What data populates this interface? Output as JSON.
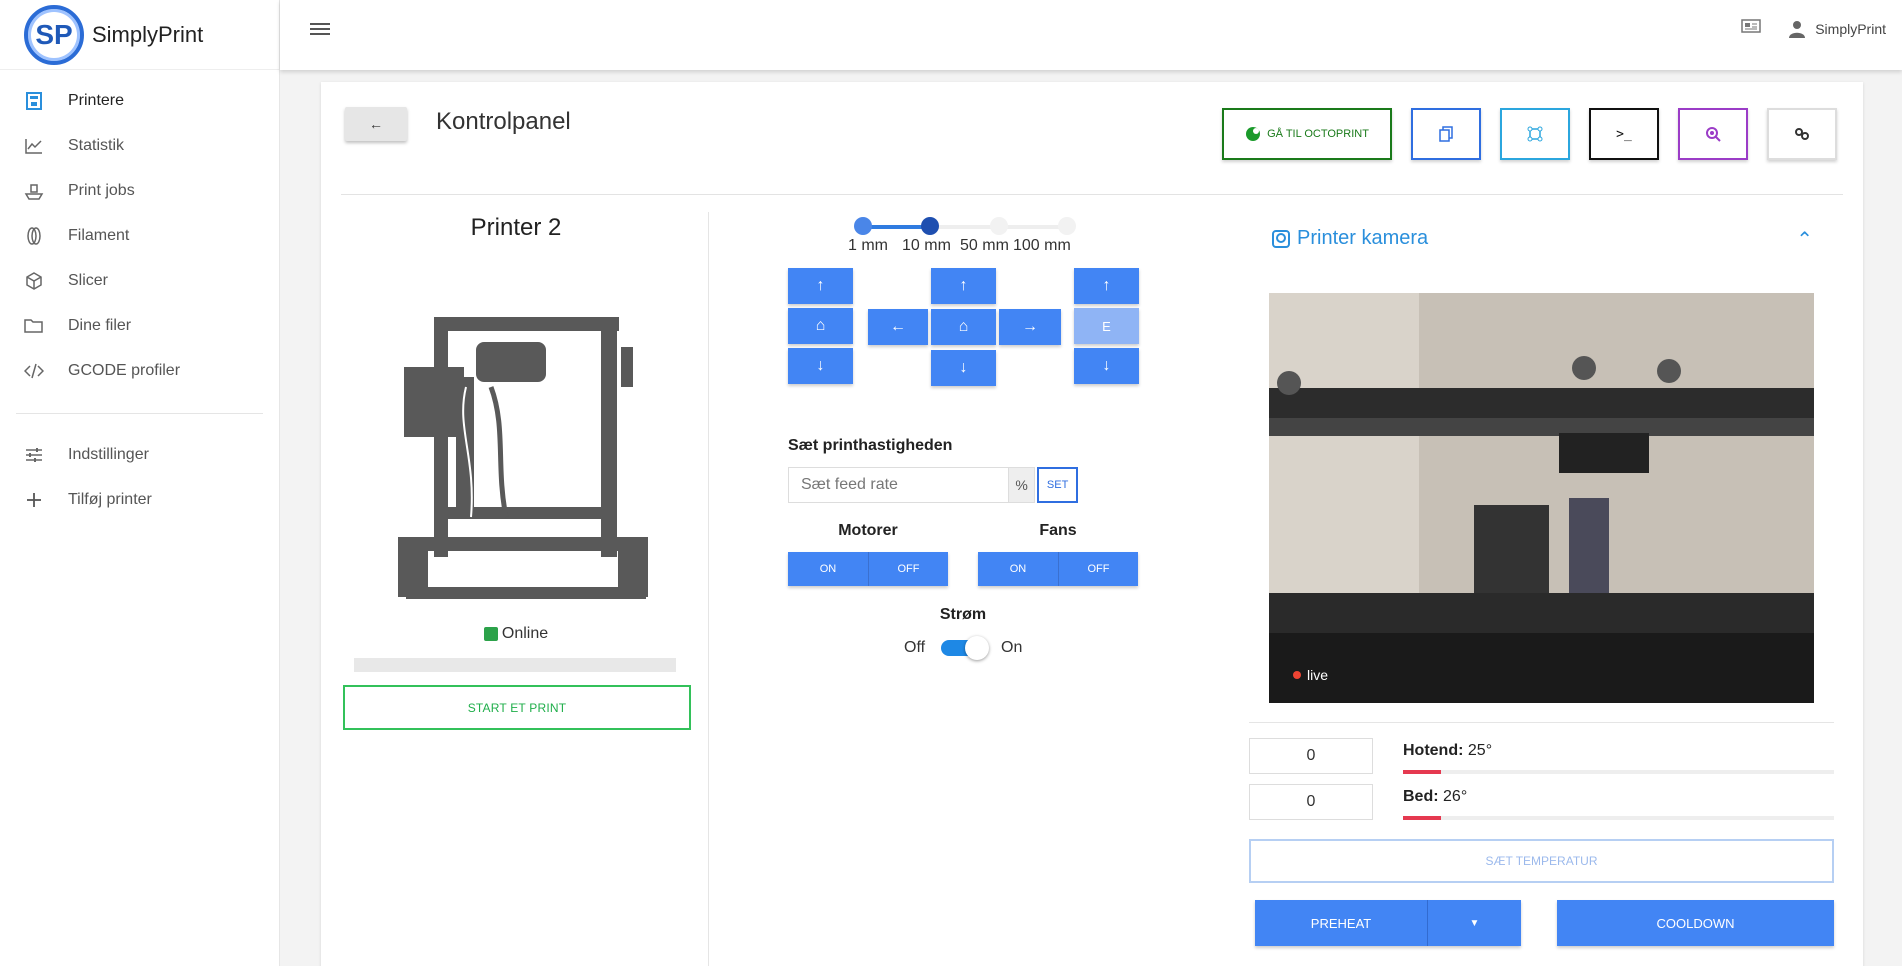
{
  "brand": {
    "name": "SimplyPrint",
    "logo_text": "SP"
  },
  "sidebar": {
    "items": [
      {
        "label": "Printere",
        "icon": "printer-icon"
      },
      {
        "label": "Statistik",
        "icon": "chart-icon"
      },
      {
        "label": "Print jobs",
        "icon": "boat-icon"
      },
      {
        "label": "Filament",
        "icon": "filament-icon"
      },
      {
        "label": "Slicer",
        "icon": "cube-icon"
      },
      {
        "label": "Dine filer",
        "icon": "folder-icon"
      },
      {
        "label": "GCODE profiler",
        "icon": "code-icon"
      }
    ],
    "bottom": [
      {
        "label": "Indstillinger",
        "icon": "sliders-icon"
      },
      {
        "label": "Tilføj printer",
        "icon": "plus-icon"
      }
    ]
  },
  "topbar": {
    "user": "SimplyPrint"
  },
  "page": {
    "title": "Kontrolpanel",
    "octoprint_label": "GÅ TIL OCTOPRINT"
  },
  "printer": {
    "name": "Printer 2",
    "status": "Online",
    "status_color": "#2ca24a",
    "start_label": "START ET PRINT"
  },
  "jog": {
    "steps": [
      "1 mm",
      "10 mm",
      "50 mm",
      "100 mm"
    ],
    "selected_step": "10 mm",
    "e_label": "E"
  },
  "feed": {
    "label": "Sæt printhastigheden",
    "placeholder": "Sæt feed rate",
    "unit": "%",
    "set_label": "SET"
  },
  "motors": {
    "label": "Motorer",
    "on": "ON",
    "off": "OFF"
  },
  "fans": {
    "label": "Fans",
    "on": "ON",
    "off": "OFF"
  },
  "power": {
    "label": "Strøm",
    "off": "Off",
    "on": "On",
    "state": "on"
  },
  "camera": {
    "title": "Printer kamera",
    "live": "live"
  },
  "temps": {
    "hotend": {
      "label": "Hotend:",
      "value": "25°",
      "input": "0"
    },
    "bed": {
      "label": "Bed:",
      "value": "26°",
      "input": "0"
    },
    "set_label": "SÆT TEMPERATUR",
    "preheat_label": "PREHEAT",
    "cooldown_label": "COOLDOWN"
  }
}
